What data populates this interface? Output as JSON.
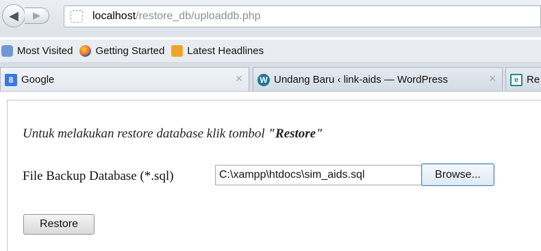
{
  "browser": {
    "url_host": "localhost",
    "url_path": "/restore_db/uploaddb.php"
  },
  "bookmarks": [
    {
      "label": "Most Visited",
      "icon": "most-visited-icon"
    },
    {
      "label": "Getting Started",
      "icon": "firefox-icon"
    },
    {
      "label": "Latest Headlines",
      "icon": "rss-icon"
    }
  ],
  "tabs": [
    {
      "label": "Google",
      "icon": "google-icon",
      "icon_glyph": "8"
    },
    {
      "label": "Undang Baru ‹ link-aids — WordPress",
      "icon": "wordpress-icon",
      "icon_glyph": "W"
    },
    {
      "label": "Re",
      "icon": "re-icon",
      "icon_glyph": "e"
    }
  ],
  "tab_close_glyph": "×",
  "page": {
    "instruction_text": "Untuk melakukan restore database klik tombol ",
    "instruction_bold": "\"Restore\"",
    "file_label": "File Backup Database (*.sql)",
    "file_value": "C:\\xampp\\htdocs\\sim_aids.sql",
    "browse_label": "Browse...",
    "restore_label": "Restore"
  }
}
